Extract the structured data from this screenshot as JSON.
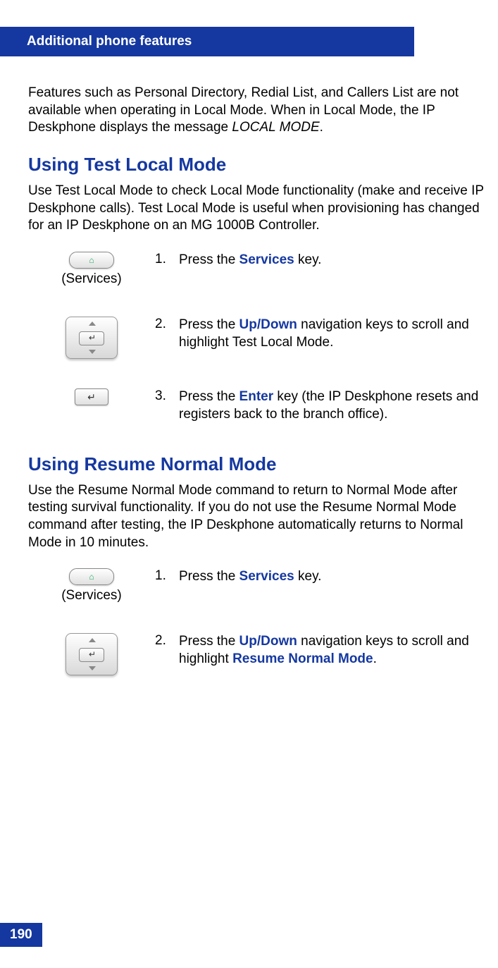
{
  "header": "Additional phone features",
  "intro": {
    "p1a": "Features such as Personal Directory, Redial List, and Callers List are not available when operating in Local Mode. When in Local Mode, the IP Deskphone displays the message ",
    "p1b": "LOCAL MODE",
    "p1c": "."
  },
  "sections": {
    "testLocal": {
      "heading": "Using Test Local Mode",
      "intro": "Use Test Local Mode to check Local Mode functionality (make and receive IP Deskphone calls). Test Local Mode is useful when provisioning has changed for an IP Deskphone on an MG 1000B Controller.",
      "steps": [
        {
          "num": "1.",
          "pre": "Press the ",
          "term": "Services",
          "post": " key.",
          "keyLabel": "(Services)",
          "icon": "services"
        },
        {
          "num": "2.",
          "pre": "Press the ",
          "term": "Up/Down",
          "post": " navigation keys to scroll and highlight Test Local Mode.",
          "keyLabel": "",
          "icon": "nav"
        },
        {
          "num": "3.",
          "pre": "Press the ",
          "term": "Enter",
          "post": " key (the IP Deskphone resets and registers back to the branch office).",
          "keyLabel": "",
          "icon": "enter"
        }
      ]
    },
    "resumeNormal": {
      "heading": "Using Resume Normal Mode",
      "intro": "Use the Resume Normal Mode command to return to Normal Mode after testing survival functionality. If you do not use the Resume Normal Mode command after testing, the IP Deskphone automatically returns to Normal Mode in 10 minutes.",
      "steps": [
        {
          "num": "1.",
          "pre": "Press the ",
          "term": "Services",
          "post": " key.",
          "keyLabel": "(Services)",
          "icon": "services"
        },
        {
          "num": "2.",
          "pre": "Press the ",
          "term": "Up/Down",
          "post": " navigation keys to scroll and highlight ",
          "term2": "Resume Normal Mode",
          "post2": ".",
          "keyLabel": "",
          "icon": "nav"
        }
      ]
    }
  },
  "pageNumber": "190"
}
